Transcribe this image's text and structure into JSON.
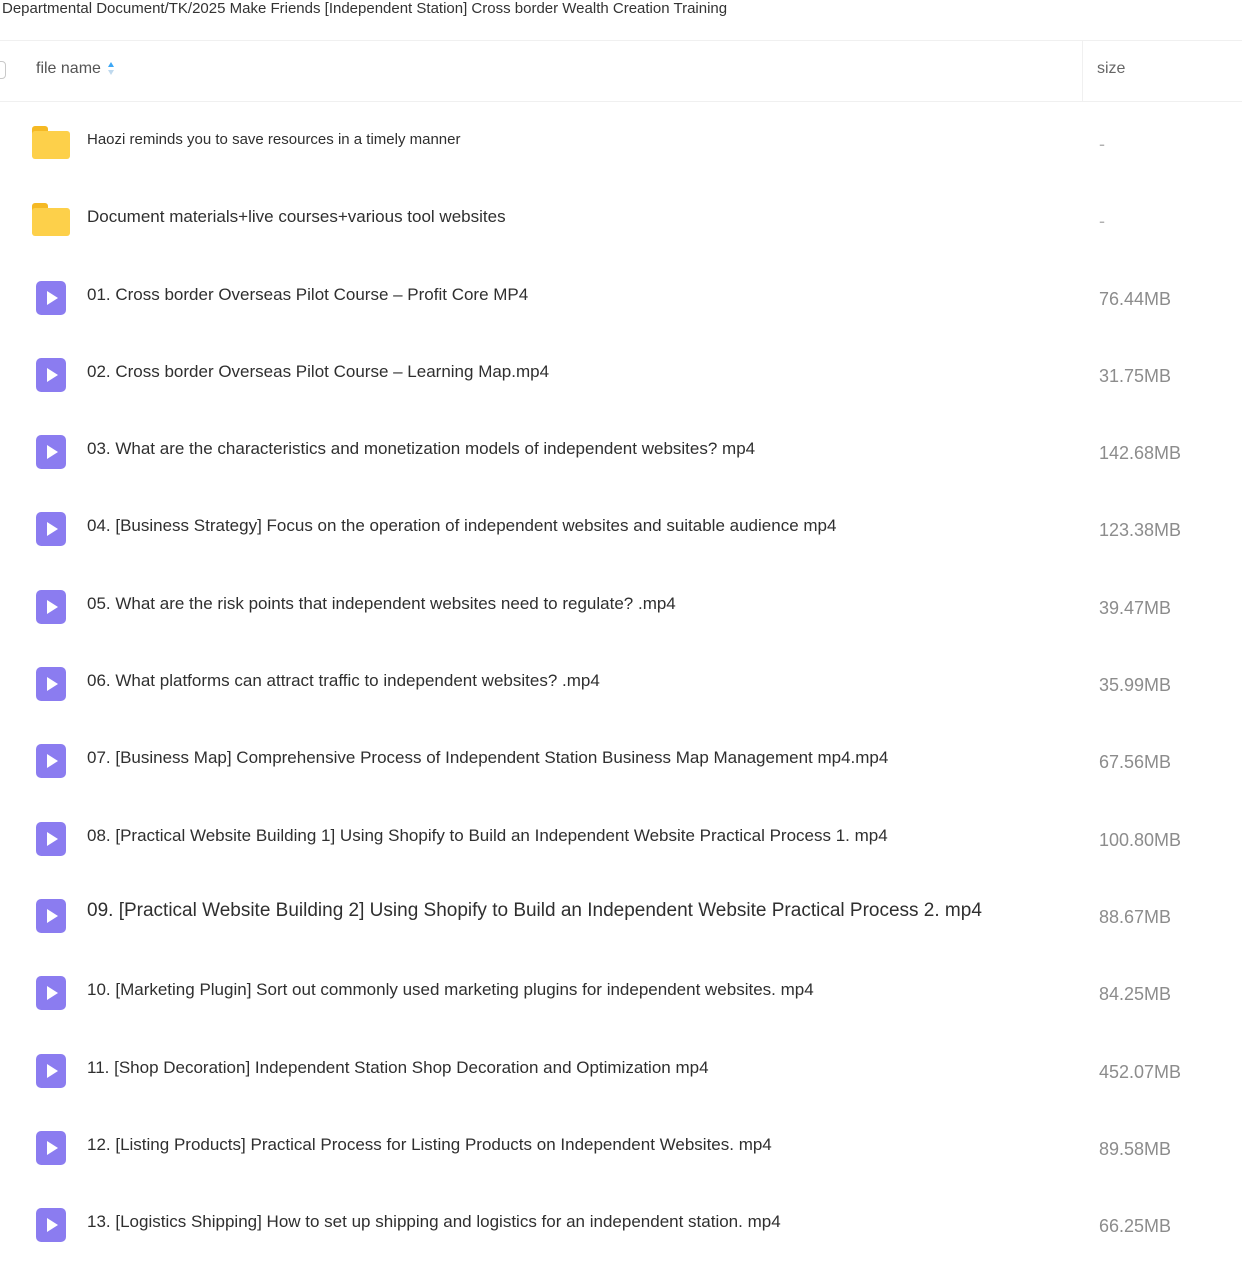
{
  "breadcrumb": "Departmental Document/TK/2025 Make Friends [Independent Station] Cross border Wealth Creation Training",
  "columns": {
    "name": "file name",
    "size": "size"
  },
  "files": [
    {
      "type": "folder",
      "icon": "folder-icon",
      "name": "Haozi reminds you to save resources in a timely manner",
      "size": "-"
    },
    {
      "type": "folder",
      "icon": "folder-icon",
      "name": "Document materials+live courses+various tool websites",
      "size": "-"
    },
    {
      "type": "video",
      "icon": "video-icon",
      "name": "01. Cross border Overseas Pilot Course – Profit Core MP4",
      "size": "76.44MB"
    },
    {
      "type": "video",
      "icon": "video-icon",
      "name": "02. Cross border Overseas Pilot Course – Learning Map.mp4",
      "size": "31.75MB"
    },
    {
      "type": "video",
      "icon": "video-icon",
      "name": "03. What are the characteristics and monetization models of independent websites? mp4",
      "size": "142.68MB"
    },
    {
      "type": "video",
      "icon": "video-icon",
      "name": "04. [Business Strategy] Focus on the operation of independent websites and suitable audience mp4",
      "size": "123.38MB"
    },
    {
      "type": "video",
      "icon": "video-icon",
      "name": "05. What are the risk points that independent websites need to regulate? .mp4",
      "size": "39.47MB"
    },
    {
      "type": "video",
      "icon": "video-icon",
      "name": "06. What platforms can attract traffic to independent websites? .mp4",
      "size": "35.99MB"
    },
    {
      "type": "video",
      "icon": "video-icon",
      "name": "07. [Business Map] Comprehensive Process of Independent Station Business Map Management mp4.mp4",
      "size": "67.56MB"
    },
    {
      "type": "video",
      "icon": "video-icon",
      "name": "08. [Practical Website Building 1] Using Shopify to Build an Independent Website Practical Process 1. mp4",
      "size": "100.80MB"
    },
    {
      "type": "video",
      "icon": "video-icon",
      "name": "09. [Practical Website Building 2] Using Shopify to Build an Independent Website Practical Process 2. mp4",
      "size": "88.67MB"
    },
    {
      "type": "video",
      "icon": "video-icon",
      "name": "10. [Marketing Plugin] Sort out commonly used marketing plugins for independent websites. mp4",
      "size": "84.25MB"
    },
    {
      "type": "video",
      "icon": "video-icon",
      "name": "11. [Shop Decoration] Independent Station Shop Decoration and Optimization mp4",
      "size": "452.07MB"
    },
    {
      "type": "video",
      "icon": "video-icon",
      "name": "12. [Listing Products] Practical Process for Listing Products on Independent Websites. mp4",
      "size": "89.58MB"
    },
    {
      "type": "video",
      "icon": "video-icon",
      "name": "13. [Logistics Shipping] How to set up shipping and logistics for an independent station. mp4",
      "size": "66.25MB"
    }
  ]
}
